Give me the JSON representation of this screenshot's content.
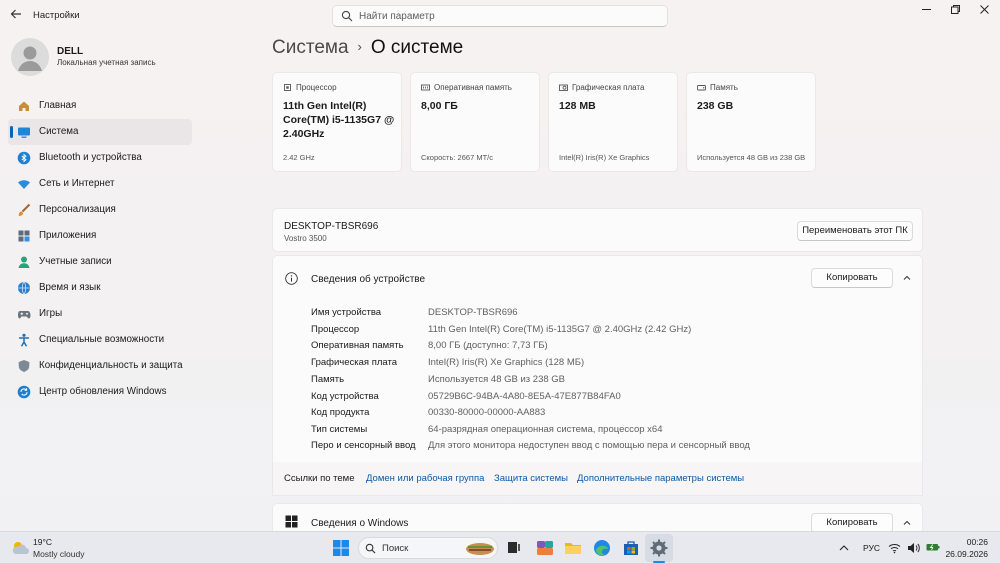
{
  "window": {
    "title": "Настройки",
    "search_placeholder": "Найти параметр"
  },
  "profile": {
    "name": "DELL",
    "subtitle": "Локальная учетная запись"
  },
  "sidebar": {
    "items": [
      {
        "label": "Главная",
        "icon": "home-icon"
      },
      {
        "label": "Система",
        "icon": "system-icon",
        "active": true
      },
      {
        "label": "Bluetooth и устройства",
        "icon": "bluetooth-icon"
      },
      {
        "label": "Сеть и Интернет",
        "icon": "wifi-icon"
      },
      {
        "label": "Персонализация",
        "icon": "brush-icon"
      },
      {
        "label": "Приложения",
        "icon": "apps-icon"
      },
      {
        "label": "Учетные записи",
        "icon": "accounts-icon"
      },
      {
        "label": "Время и язык",
        "icon": "globe-icon"
      },
      {
        "label": "Игры",
        "icon": "gamepad-icon"
      },
      {
        "label": "Специальные возможности",
        "icon": "accessibility-icon"
      },
      {
        "label": "Конфиденциальность и защита",
        "icon": "shield-icon"
      },
      {
        "label": "Центр обновления Windows",
        "icon": "update-icon"
      }
    ]
  },
  "breadcrumb": {
    "parent": "Система",
    "separator": "›",
    "current": "О системе"
  },
  "cards": [
    {
      "heading": "Процессор",
      "value": "11th Gen Intel(R) Core(TM) i5-1135G7 @ 2.40GHz",
      "footer": "2.42 GHz",
      "icon": "cpu-icon"
    },
    {
      "heading": "Оперативная память",
      "value": "8,00 ГБ",
      "footer": "Скорость: 2667 MT/c",
      "icon": "ram-icon"
    },
    {
      "heading": "Графическая плата",
      "value": "128 MB",
      "footer": "Intel(R) Iris(R) Xe Graphics",
      "icon": "gpu-icon"
    },
    {
      "heading": "Память",
      "value": "238 GB",
      "footer": "Используется 48 GB из 238 GB",
      "icon": "storage-icon"
    }
  ],
  "pc": {
    "name": "DESKTOP-TBSR696",
    "model": "Vostro 3500",
    "rename_label": "Переименовать этот ПК"
  },
  "device_specs": {
    "title": "Сведения об устройстве",
    "copy_label": "Копировать",
    "rows": [
      {
        "key": "Имя устройства",
        "value": "DESKTOP-TBSR696"
      },
      {
        "key": "Процессор",
        "value": "11th Gen Intel(R) Core(TM) i5-1135G7 @ 2.40GHz (2.42 GHz)"
      },
      {
        "key": "Оперативная память",
        "value": "8,00 ГБ (доступно: 7,73 ГБ)"
      },
      {
        "key": "Графическая плата",
        "value": "Intel(R) Iris(R) Xe Graphics (128 МБ)"
      },
      {
        "key": "Память",
        "value": "Используется 48 GB из 238 GB"
      },
      {
        "key": "Код устройства",
        "value": "05729B6C-94BA-4A80-8E5A-47E877B84FA0"
      },
      {
        "key": "Код продукта",
        "value": "00330-80000-00000-AA883"
      },
      {
        "key": "Тип системы",
        "value": "64-разрядная операционная система, процессор x64"
      },
      {
        "key": "Перо и сенсорный ввод",
        "value": "Для этого монитора недоступен ввод с помощью пера и сенсорный ввод"
      }
    ]
  },
  "related_links": {
    "label": "Ссылки по теме",
    "links": [
      "Домен или рабочая группа",
      "Защита системы",
      "Дополнительные параметры системы"
    ]
  },
  "windows_specs": {
    "title": "Сведения о Windows",
    "copy_label": "Копировать"
  },
  "taskbar": {
    "weather_temp": "19°C",
    "weather_desc": "Mostly cloudy",
    "search_label": "Поиск",
    "language": "РУС",
    "time": "00:26",
    "date": "26.09.2026"
  },
  "colors": {
    "accent": "#0067c0",
    "link": "#0a5aa8"
  }
}
